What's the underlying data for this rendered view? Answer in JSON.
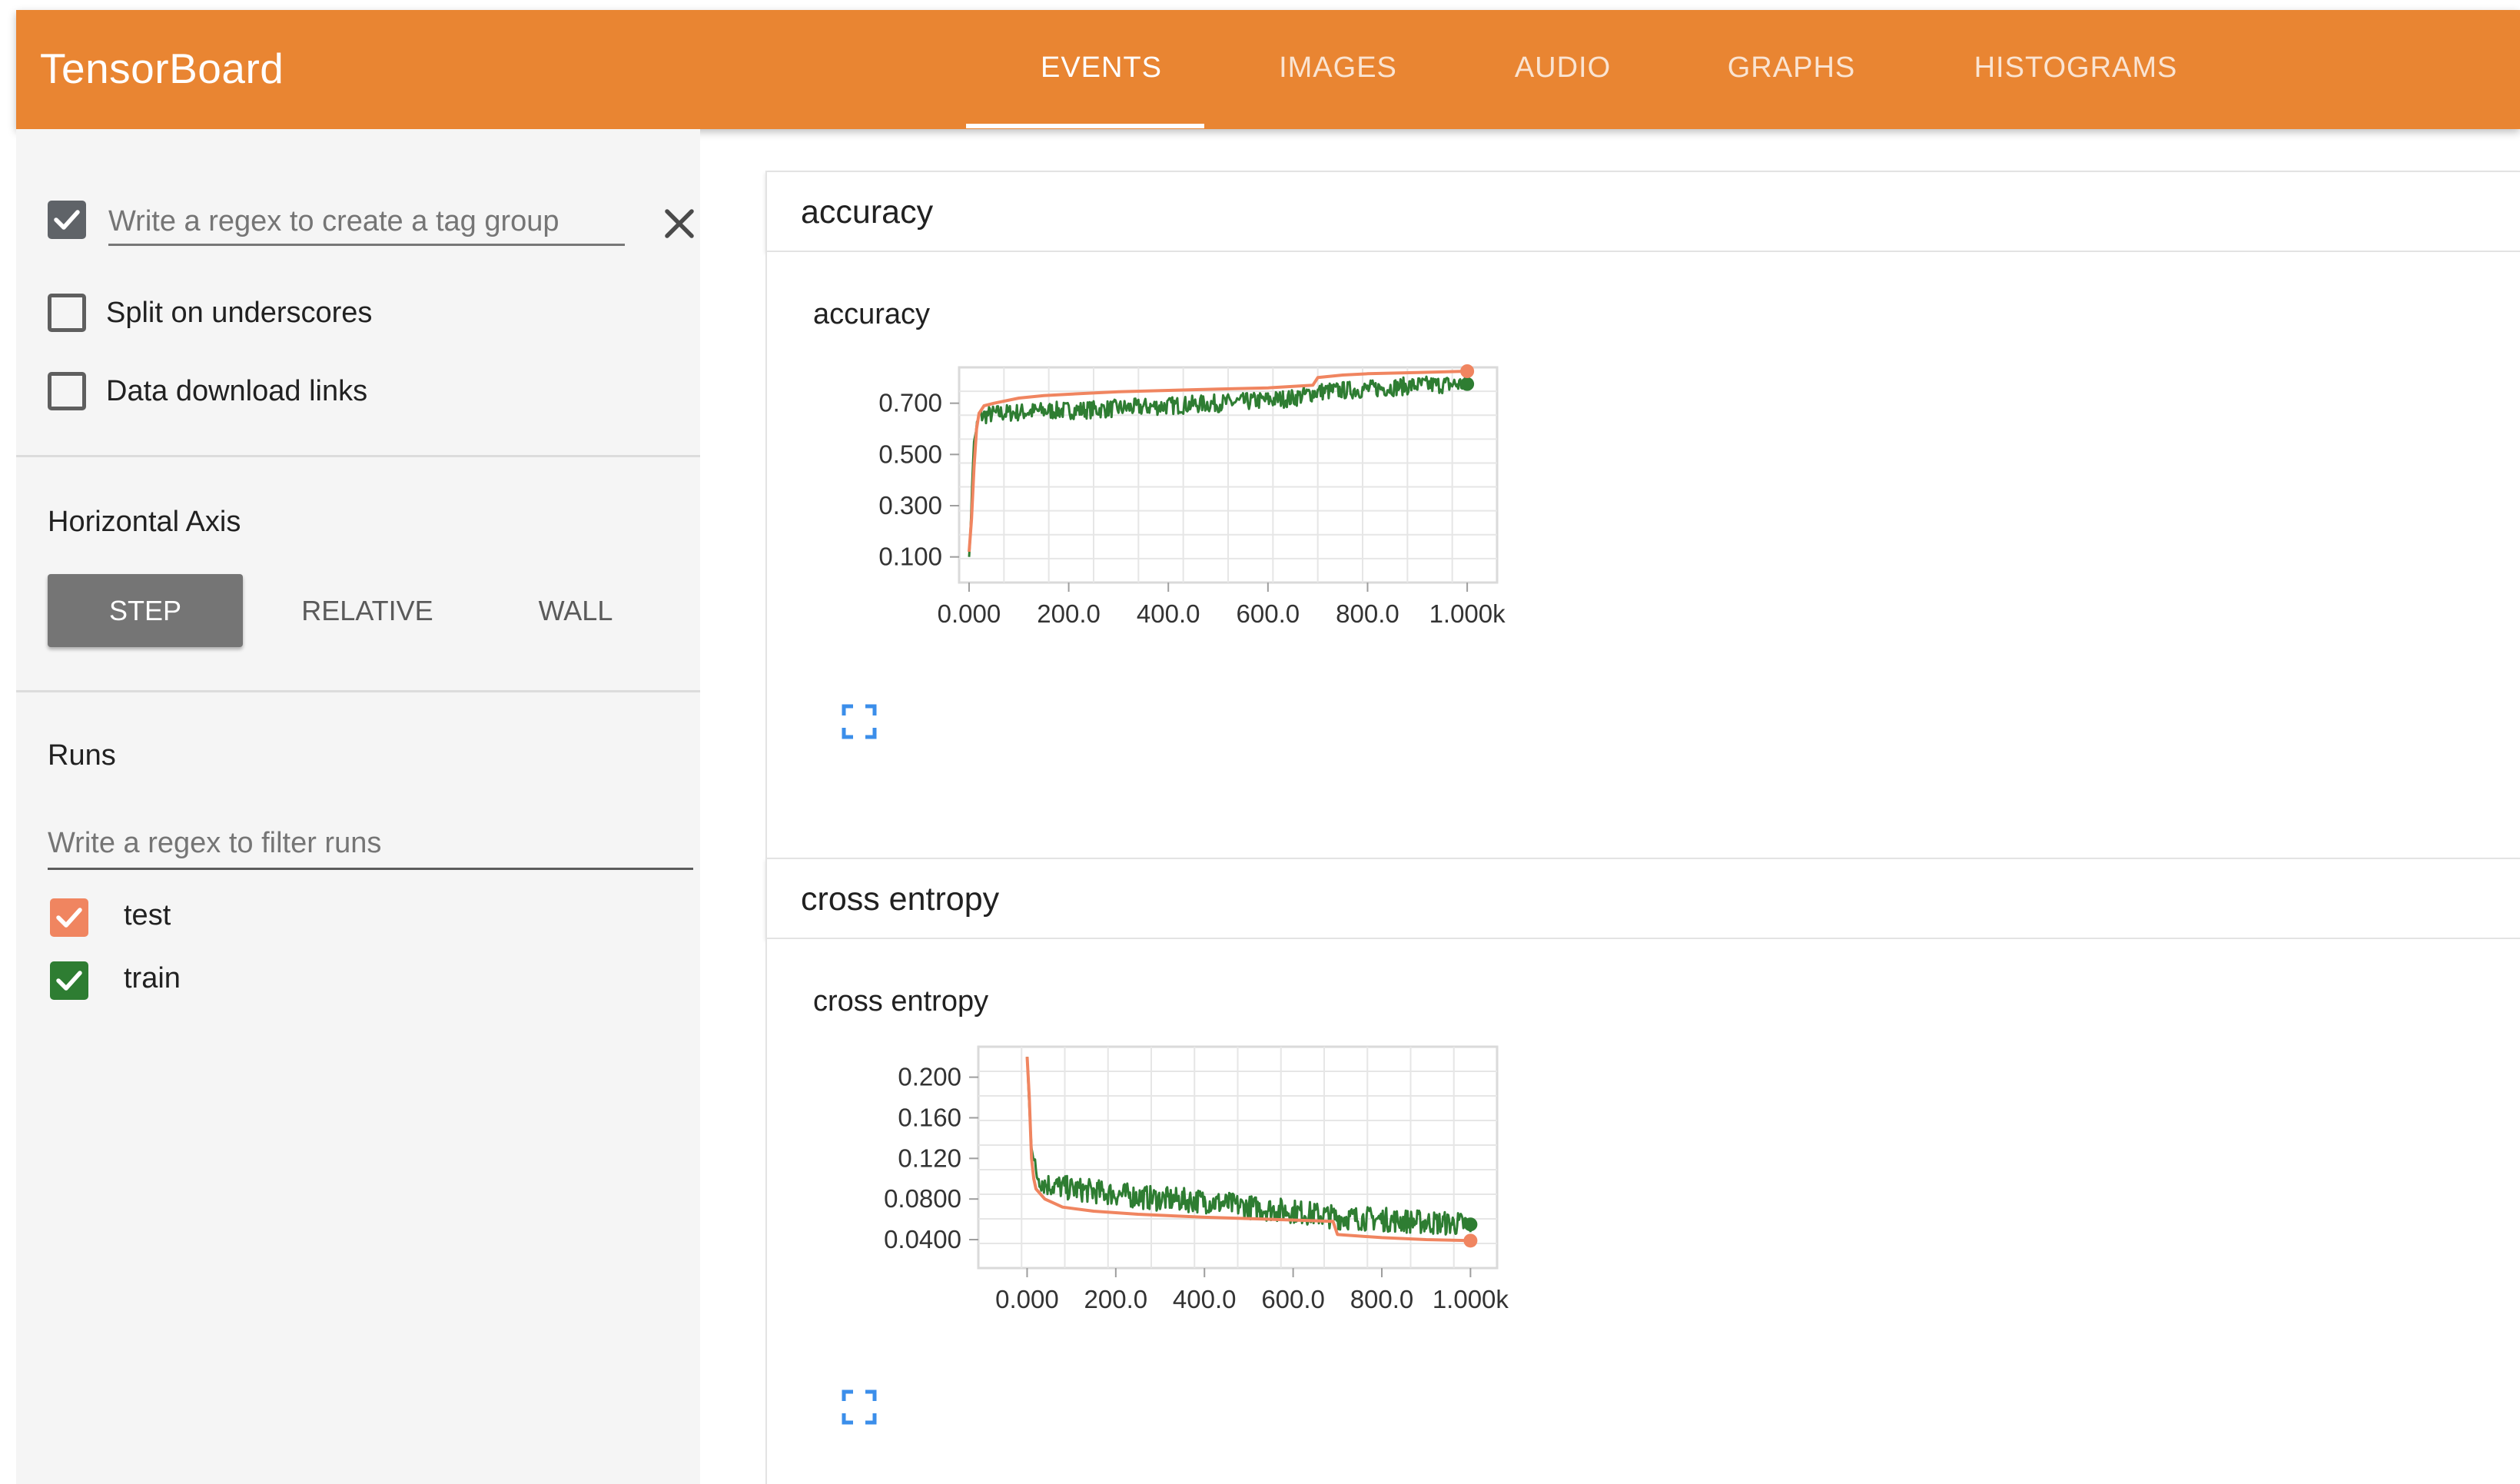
{
  "app": {
    "title": "TensorBoard"
  },
  "nav": {
    "tabs": [
      {
        "label": "EVENTS",
        "active": true
      },
      {
        "label": "IMAGES",
        "active": false
      },
      {
        "label": "AUDIO",
        "active": false
      },
      {
        "label": "GRAPHS",
        "active": false
      },
      {
        "label": "HISTOGRAMS",
        "active": false
      }
    ]
  },
  "sidebar": {
    "tag_group": {
      "checked": true,
      "placeholder": "Write a regex to create a tag group",
      "value": ""
    },
    "split_on_underscores": {
      "label": "Split on underscores",
      "checked": false
    },
    "data_download_links": {
      "label": "Data download links",
      "checked": false
    },
    "horizontal_axis": {
      "label": "Horizontal Axis",
      "options": [
        "STEP",
        "RELATIVE",
        "WALL"
      ],
      "selected": "STEP"
    },
    "runs": {
      "label": "Runs",
      "filter_placeholder": "Write a regex to filter runs",
      "items": [
        {
          "name": "test",
          "checked": true,
          "color": "#f08560"
        },
        {
          "name": "train",
          "checked": true,
          "color": "#2e7d32"
        }
      ]
    }
  },
  "icons": {
    "close": "close-icon",
    "checkmark": "check-icon",
    "expand": "fullscreen-icon"
  },
  "colors": {
    "brand": "#e98532",
    "test": "#f08560",
    "train": "#2e7d32"
  },
  "panes": [
    {
      "header": "accuracy",
      "chart_title": "accuracy"
    },
    {
      "header": "cross entropy",
      "chart_title": "cross entropy"
    }
  ],
  "chart_data": [
    {
      "type": "line",
      "title": "accuracy",
      "xlabel": "",
      "ylabel": "",
      "xlim": [
        -20,
        1060
      ],
      "ylim": [
        0.0,
        0.84
      ],
      "x_ticks": [
        0,
        200,
        400,
        600,
        800,
        1000
      ],
      "x_tick_labels": [
        "0.000",
        "200.0",
        "400.0",
        "600.0",
        "800.0",
        "1.000k"
      ],
      "y_ticks": [
        0.1,
        0.3,
        0.5,
        0.7
      ],
      "y_tick_labels": [
        "0.100",
        "0.300",
        "0.500",
        "0.700"
      ],
      "grid": true,
      "series": [
        {
          "name": "test",
          "color": "#f08560",
          "points": [
            [
              0,
              0.12
            ],
            [
              5,
              0.25
            ],
            [
              10,
              0.45
            ],
            [
              15,
              0.6
            ],
            [
              20,
              0.66
            ],
            [
              30,
              0.69
            ],
            [
              50,
              0.7
            ],
            [
              100,
              0.72
            ],
            [
              150,
              0.73
            ],
            [
              200,
              0.735
            ],
            [
              300,
              0.745
            ],
            [
              400,
              0.75
            ],
            [
              500,
              0.755
            ],
            [
              600,
              0.76
            ],
            [
              690,
              0.77
            ],
            [
              700,
              0.8
            ],
            [
              750,
              0.81
            ],
            [
              800,
              0.815
            ],
            [
              900,
              0.82
            ],
            [
              1000,
              0.825
            ]
          ]
        },
        {
          "name": "train",
          "color": "#2e7d32",
          "points": [
            [
              0,
              0.1
            ],
            [
              3,
              0.2
            ],
            [
              6,
              0.38
            ],
            [
              10,
              0.55
            ],
            [
              15,
              0.6
            ],
            [
              20,
              0.65
            ],
            [
              60,
              0.66
            ],
            [
              150,
              0.67
            ],
            [
              250,
              0.675
            ],
            [
              350,
              0.685
            ],
            [
              450,
              0.695
            ],
            [
              550,
              0.705
            ],
            [
              650,
              0.72
            ],
            [
              700,
              0.745
            ],
            [
              800,
              0.755
            ],
            [
              900,
              0.77
            ],
            [
              1000,
              0.775
            ]
          ],
          "noise": 0.035
        }
      ]
    },
    {
      "type": "line",
      "title": "cross entropy",
      "xlabel": "",
      "ylabel": "",
      "xlim": [
        -110,
        1060
      ],
      "ylim": [
        0.012,
        0.23
      ],
      "x_ticks": [
        0,
        200,
        400,
        600,
        800,
        1000
      ],
      "x_tick_labels": [
        "0.000",
        "200.0",
        "400.0",
        "600.0",
        "800.0",
        "1.000k"
      ],
      "y_ticks": [
        0.04,
        0.08,
        0.12,
        0.16,
        0.2
      ],
      "y_tick_labels": [
        "0.0400",
        "0.0800",
        "0.120",
        "0.160",
        "0.200"
      ],
      "grid": true,
      "series": [
        {
          "name": "test",
          "color": "#f08560",
          "points": [
            [
              0,
              0.22
            ],
            [
              5,
              0.18
            ],
            [
              10,
              0.12
            ],
            [
              15,
              0.1
            ],
            [
              20,
              0.09
            ],
            [
              40,
              0.08
            ],
            [
              80,
              0.072
            ],
            [
              150,
              0.068
            ],
            [
              250,
              0.065
            ],
            [
              400,
              0.062
            ],
            [
              550,
              0.06
            ],
            [
              690,
              0.058
            ],
            [
              700,
              0.045
            ],
            [
              800,
              0.042
            ],
            [
              900,
              0.04
            ],
            [
              1000,
              0.039
            ]
          ]
        },
        {
          "name": "train",
          "color": "#2e7d32",
          "points": [
            [
              0,
              0.22
            ],
            [
              5,
              0.17
            ],
            [
              10,
              0.13
            ],
            [
              20,
              0.105
            ],
            [
              40,
              0.095
            ],
            [
              100,
              0.09
            ],
            [
              200,
              0.085
            ],
            [
              300,
              0.08
            ],
            [
              400,
              0.078
            ],
            [
              500,
              0.072
            ],
            [
              600,
              0.068
            ],
            [
              700,
              0.062
            ],
            [
              800,
              0.06
            ],
            [
              900,
              0.057
            ],
            [
              1000,
              0.055
            ]
          ],
          "noise": 0.012
        }
      ]
    }
  ]
}
